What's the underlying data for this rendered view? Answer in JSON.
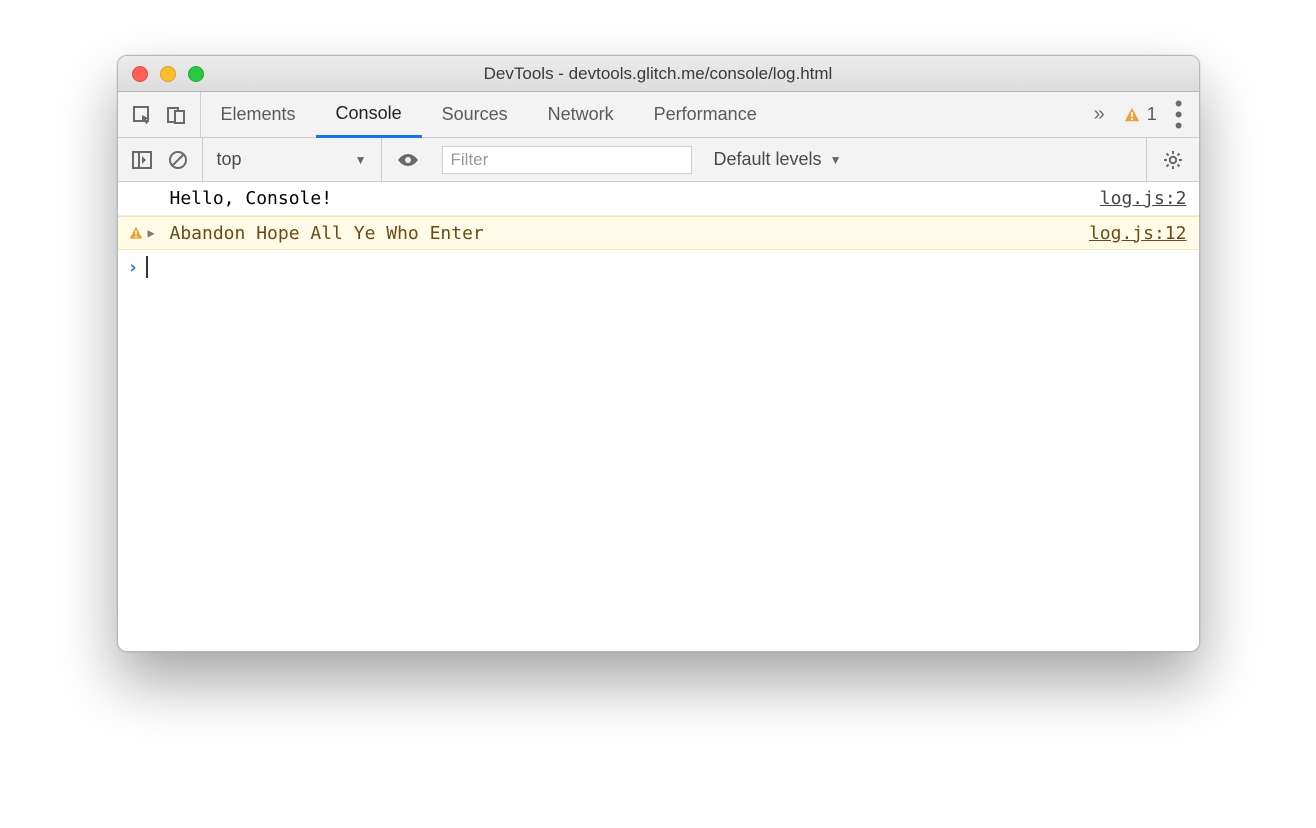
{
  "window": {
    "title": "DevTools - devtools.glitch.me/console/log.html"
  },
  "tabs": {
    "items": [
      "Elements",
      "Console",
      "Sources",
      "Network",
      "Performance"
    ],
    "active_index": 1
  },
  "warn_count": "1",
  "toolbar": {
    "context": "top",
    "filter_placeholder": "Filter",
    "levels_label": "Default levels"
  },
  "logs": [
    {
      "type": "log",
      "text": "Hello, Console!",
      "source": "log.js:2"
    },
    {
      "type": "warn",
      "text": "Abandon Hope All Ye Who Enter",
      "source": "log.js:12"
    }
  ]
}
